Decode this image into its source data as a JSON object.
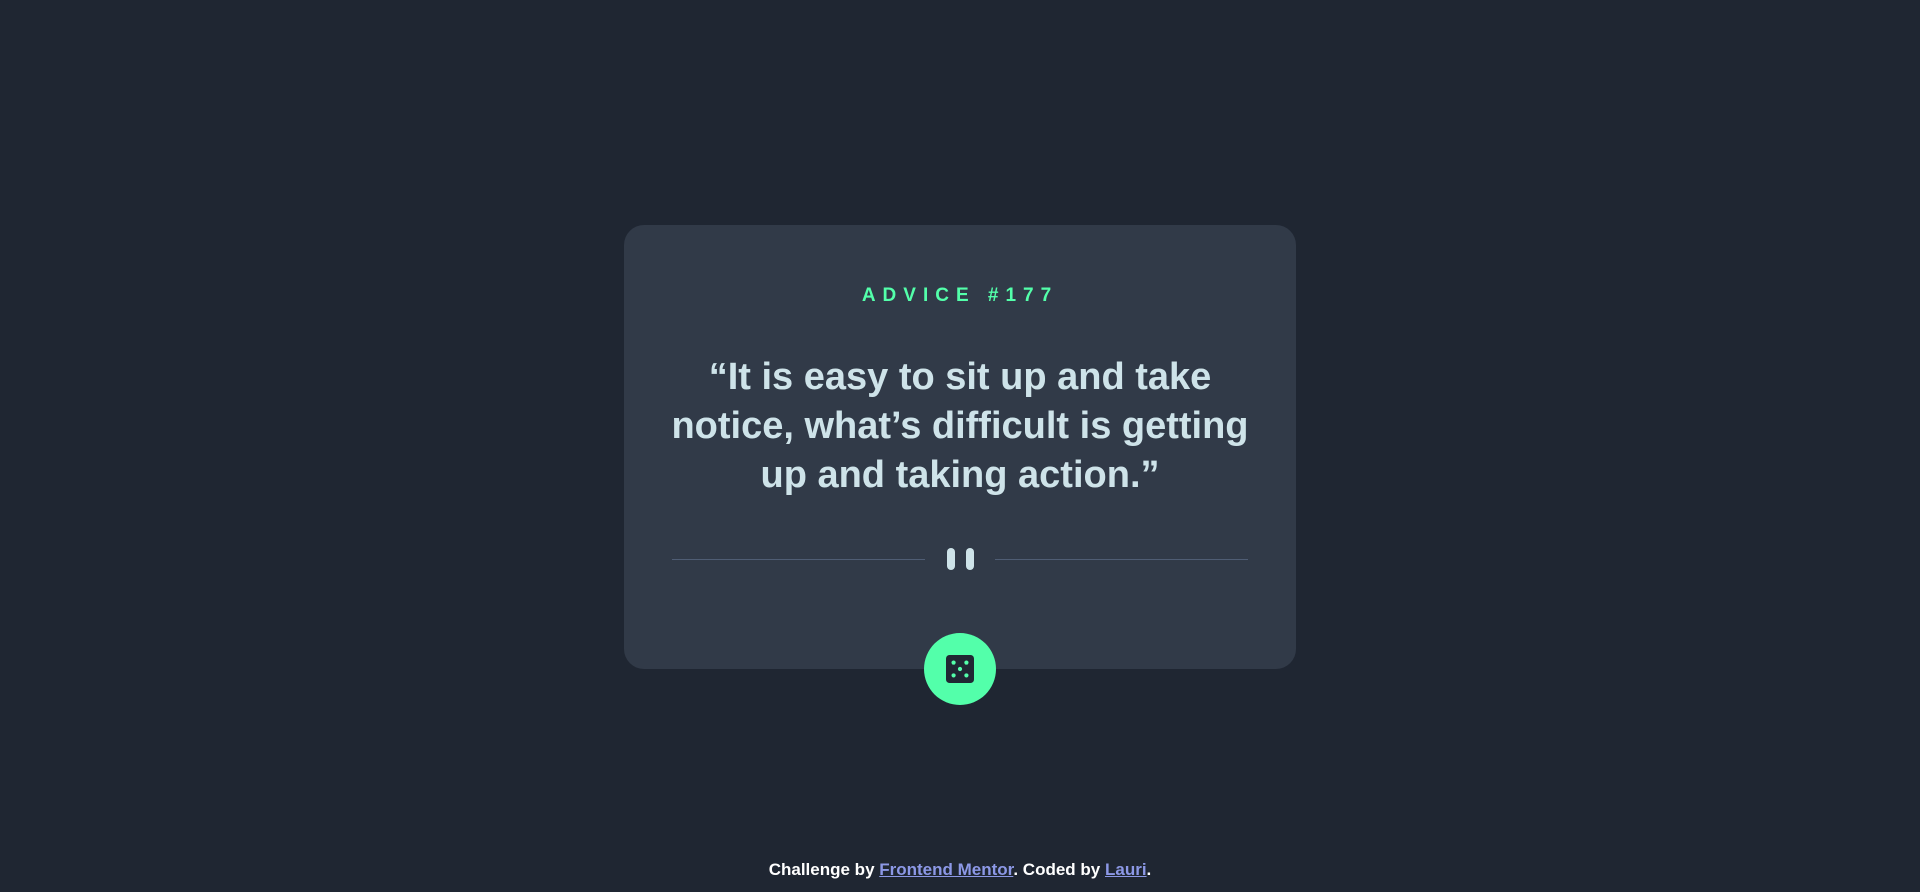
{
  "card": {
    "advice_id": "ADVICE #177",
    "advice_text": "“It is easy to sit up and take notice, what’s difficult is getting up and taking action.”"
  },
  "divider": {
    "icon": "pause-icon"
  },
  "dice_button": {
    "icon": "dice-icon"
  },
  "footer": {
    "prefix": "Challenge by ",
    "challenge_link": "Frontend Mentor",
    "middle": ". Coded by ",
    "author_link": "Lauri",
    "suffix": "."
  },
  "colors": {
    "background": "#1f2632",
    "card": "#313a48",
    "accent": "#53ffaa",
    "text": "#cee3e9",
    "link": "#8c98e6"
  }
}
